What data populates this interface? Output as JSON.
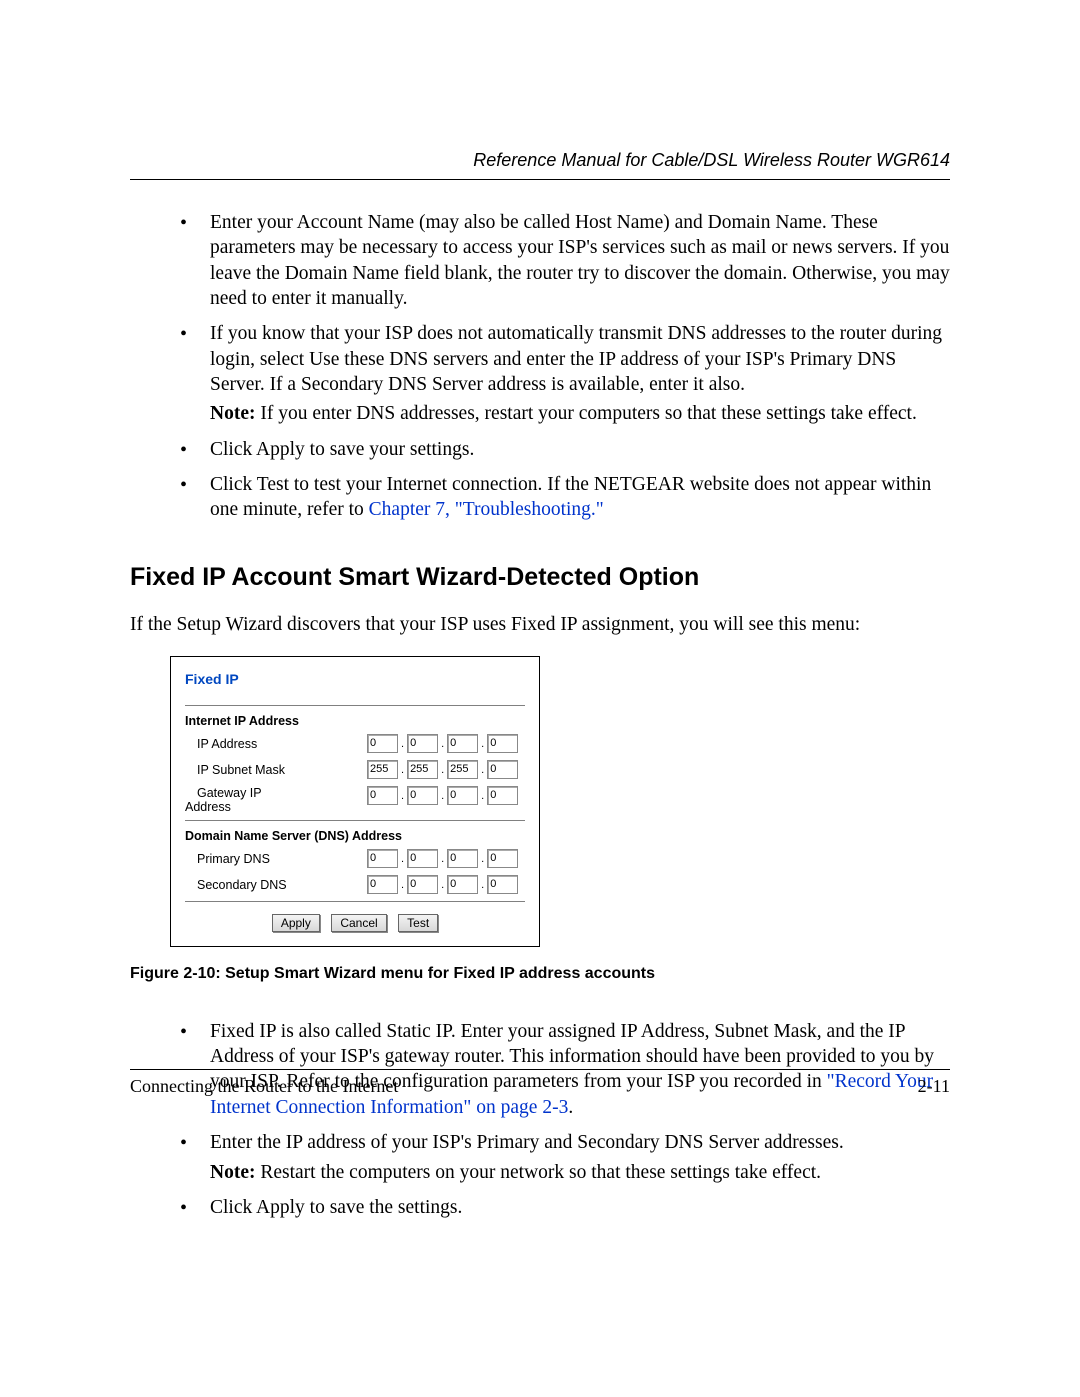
{
  "header": {
    "title": "Reference Manual for Cable/DSL Wireless Router WGR614"
  },
  "topBullets": [
    {
      "text": "Enter your Account Name (may also be called Host Name) and Domain Name. These parameters may be necessary to access your ISP's services such as mail or news servers. If you leave the Domain Name field blank, the router try to discover the domain. Otherwise, you may need to enter it manually."
    },
    {
      "text": "If you know that your ISP does not automatically transmit DNS addresses to the router during login, select Use these DNS servers and enter the IP address of your ISP's Primary DNS Server. If a Secondary DNS Server address is available, enter it also.",
      "noteLabel": "Note:",
      "note": " If you enter DNS addresses, restart your computers so that these settings take effect."
    },
    {
      "text": "Click Apply to save your settings."
    },
    {
      "textPrefix": "Click Test to test your Internet connection. If the NETGEAR website does not appear within one minute, refer to ",
      "link": "Chapter 7, \"Troubleshooting.\""
    }
  ],
  "sectionHeading": "Fixed IP Account Smart Wizard-Detected Option",
  "introPara": "If the Setup Wizard discovers that your ISP uses Fixed IP assignment, you will see this menu:",
  "panel": {
    "title": "Fixed IP",
    "ipSection": {
      "heading": "Internet IP Address",
      "rows": {
        "ipAddress": {
          "label": "IP Address",
          "octets": [
            "0",
            "0",
            "0",
            "0"
          ]
        },
        "subnet": {
          "label": "IP Subnet Mask",
          "octets": [
            "255",
            "255",
            "255",
            "0"
          ]
        },
        "gateway": {
          "label": "Gateway IP",
          "label2": "Address",
          "octets": [
            "0",
            "0",
            "0",
            "0"
          ]
        }
      }
    },
    "dnsSection": {
      "heading": "Domain Name Server (DNS) Address",
      "rows": {
        "primary": {
          "label": "Primary DNS",
          "octets": [
            "0",
            "0",
            "0",
            "0"
          ]
        },
        "secondary": {
          "label": "Secondary DNS",
          "octets": [
            "0",
            "0",
            "0",
            "0"
          ]
        }
      }
    },
    "buttons": {
      "apply": "Apply",
      "cancel": "Cancel",
      "test": "Test"
    }
  },
  "figureCaption": "Figure 2-10:  Setup Smart Wizard menu for Fixed IP address accounts",
  "bottomBullets": [
    {
      "prefix": "Fixed IP is also called Static IP. Enter your assigned IP Address, Subnet Mask, and the IP Address of your ISP's gateway router. This information should have been provided to you by your ISP. Refer to the configuration parameters from your ISP you recorded in ",
      "link": "\"Record Your Internet Connection Information\" on page 2-3",
      "suffix": "."
    },
    {
      "text": "Enter the IP address of your ISP's Primary and Secondary DNS Server addresses.",
      "noteLabel": "Note:",
      "note": " Restart the computers on your network so that these settings take effect."
    },
    {
      "text": "Click Apply to save the settings."
    }
  ],
  "footer": {
    "left": "Connecting the Router to the Internet",
    "right": "2-11"
  }
}
